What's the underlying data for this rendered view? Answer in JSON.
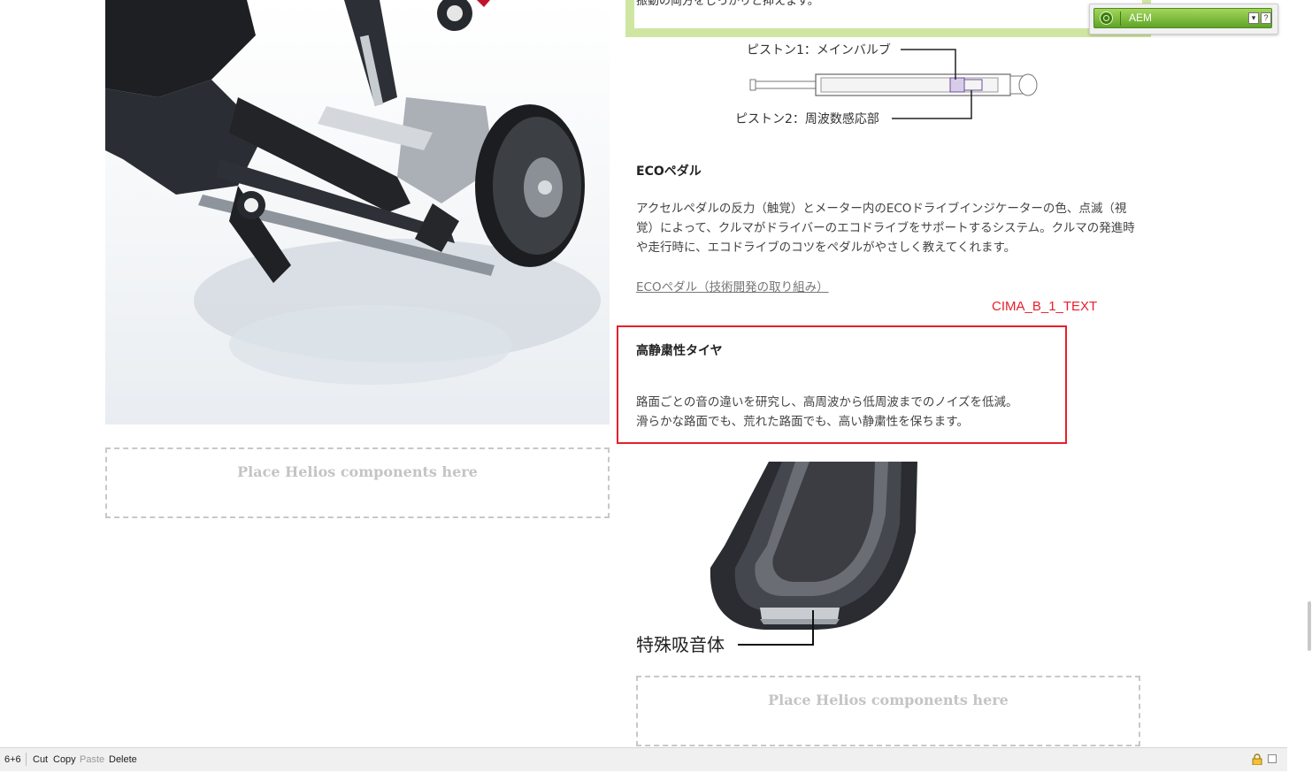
{
  "top_box": {
    "text": "振動の両方をしっかりと抑えます。"
  },
  "aem": {
    "label": "AEM",
    "dropdown_glyph": "▾",
    "help_glyph": "?"
  },
  "piston": {
    "label1": "ピストン1：メインバルブ",
    "label2": "ピストン2：周波数感応部"
  },
  "eco": {
    "title": "ECOペダル",
    "body": "アクセルペダルの反力（触覚）とメーター内のECOドライブインジケーターの色、点滅（視覚）によって、クルマがドライバーのエコドライブをサポートするシステム。クルマの発進時や走行時に、エコドライブのコツをペダルがやさしく教えてくれます。",
    "link": "ECOペダル（技術開発の取り組み）"
  },
  "component_label": "CIMA_B_1_TEXT",
  "tire_text": {
    "title": "高静粛性タイヤ",
    "line1": "路面ごとの音の違いを研究し、高周波から低周波までのノイズを低減。",
    "line2": "滑らかな路面でも、荒れた路面でも、高い静粛性を保ちます。"
  },
  "tire_image": {
    "label": "特殊吸音体"
  },
  "placeholders": {
    "left": "Place Helios components here",
    "right": "Place Helios components here"
  },
  "bottom_bar": {
    "prefix": "6+6",
    "cut": "Cut",
    "copy": "Copy",
    "paste": "Paste",
    "delete": "Delete"
  },
  "colors": {
    "highlight_red": "#e8202a",
    "aem_green": "#6cb22f",
    "top_box_border": "#cfe6a2"
  }
}
